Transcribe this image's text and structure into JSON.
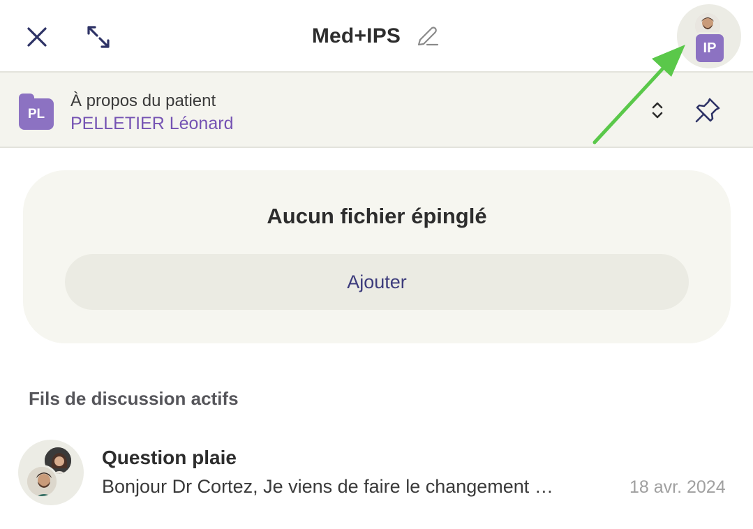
{
  "header": {
    "title": "Med+IPS",
    "avatar_initials": "IP"
  },
  "patient": {
    "label": "À propos du patient",
    "name": "PELLETIER Léonard",
    "initials": "PL"
  },
  "pinned": {
    "empty_text": "Aucun fichier épinglé",
    "add_label": "Ajouter"
  },
  "threads": {
    "section_title": "Fils de discussion actifs",
    "items": [
      {
        "title": "Question plaie",
        "preview": "Bonjour Dr Cortez, Je viens de faire le changement …",
        "date": "18 avr. 2024"
      }
    ]
  },
  "colors": {
    "accent_purple": "#8c72c2",
    "patient_name": "#7553b3",
    "icon_navy": "#2e3366",
    "annotation_arrow": "#5ac84a"
  }
}
